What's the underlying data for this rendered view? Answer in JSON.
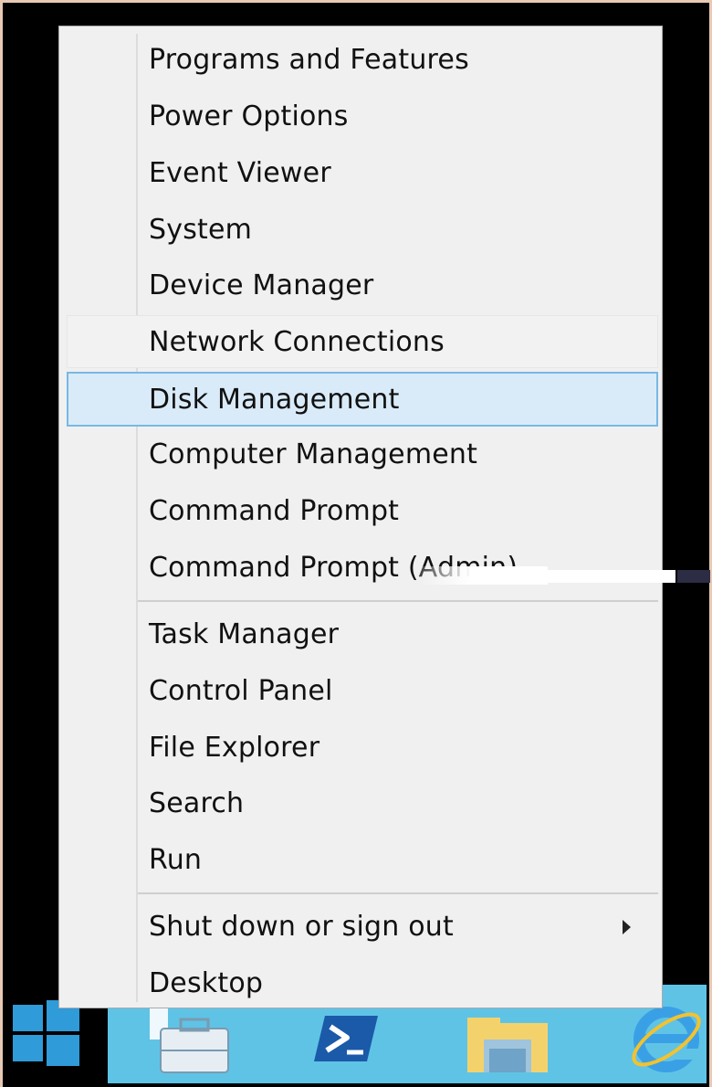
{
  "menu": {
    "items_group1": [
      {
        "label": "Programs and Features"
      },
      {
        "label": "Power Options"
      },
      {
        "label": "Event Viewer"
      },
      {
        "label": "System"
      },
      {
        "label": "Device Manager"
      },
      {
        "label": "Network Connections"
      },
      {
        "label": "Disk Management"
      },
      {
        "label": "Computer Management"
      },
      {
        "label": "Command Prompt"
      },
      {
        "label": "Command Prompt (Admin)"
      }
    ],
    "items_group2": [
      {
        "label": "Task Manager"
      },
      {
        "label": "Control Panel"
      },
      {
        "label": "File Explorer"
      },
      {
        "label": "Search"
      },
      {
        "label": "Run"
      }
    ],
    "items_group3": [
      {
        "label": "Shut down or sign out"
      },
      {
        "label": "Desktop"
      }
    ],
    "selected_item": "Disk Management"
  },
  "taskbar": {
    "icons": [
      "windows-start-icon",
      "server-manager-icon",
      "powershell-icon",
      "file-explorer-icon",
      "internet-explorer-icon"
    ]
  },
  "colors": {
    "menu_bg": "#f0f0f0",
    "selection_bg": "#d9ebf8",
    "selection_border": "#78b8e4",
    "taskbar_blue": "#5fc3e6",
    "start_blue": "#2f9bd8"
  }
}
